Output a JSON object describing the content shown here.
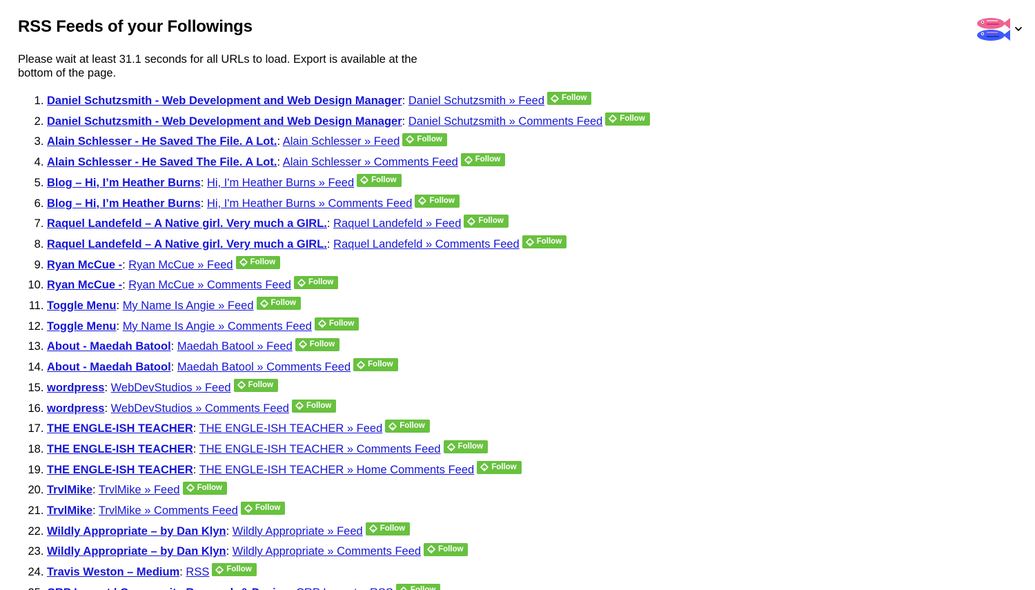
{
  "page": {
    "title": "RSS Feeds of your Followings",
    "intro": "Please wait at least 31.1 seconds for all URLs to load. Export is available at the bottom of the page."
  },
  "header": {
    "avatar_icon": "fish-avatar-icon",
    "menu_icon": "chevron-down-icon"
  },
  "colors": {
    "link": "#1515d6",
    "follow_bg": "#68c13f"
  },
  "follow_label": "Follow",
  "feeds": [
    {
      "site": "Daniel Schutzsmith - Web Development and Web Design Manager",
      "feed": "Daniel Schutzsmith » Feed"
    },
    {
      "site": "Daniel Schutzsmith - Web Development and Web Design Manager",
      "feed": "Daniel Schutzsmith » Comments Feed"
    },
    {
      "site": "Alain Schlesser - He Saved The File. A Lot.",
      "feed": "Alain Schlesser » Feed"
    },
    {
      "site": "Alain Schlesser - He Saved The File. A Lot.",
      "feed": "Alain Schlesser » Comments Feed"
    },
    {
      "site": "Blog – Hi, I’m Heather Burns",
      "feed": "Hi, I'm Heather Burns » Feed"
    },
    {
      "site": "Blog – Hi, I’m Heather Burns",
      "feed": "Hi, I'm Heather Burns » Comments Feed"
    },
    {
      "site": "Raquel Landefeld – A Native girl. Very much a GIRL.",
      "feed": "Raquel Landefeld » Feed"
    },
    {
      "site": "Raquel Landefeld – A Native girl. Very much a GIRL.",
      "feed": "Raquel Landefeld » Comments Feed"
    },
    {
      "site": "Ryan McCue -",
      "feed": "Ryan McCue » Feed"
    },
    {
      "site": "Ryan McCue -",
      "feed": "Ryan McCue » Comments Feed"
    },
    {
      "site": "Toggle Menu",
      "feed": "My Name Is Angie » Feed"
    },
    {
      "site": "Toggle Menu",
      "feed": "My Name Is Angie » Comments Feed"
    },
    {
      "site": "About - Maedah Batool",
      "feed": "Maedah Batool » Feed"
    },
    {
      "site": "About - Maedah Batool",
      "feed": "Maedah Batool » Comments Feed"
    },
    {
      "site": "wordpress",
      "feed": "WebDevStudios » Feed"
    },
    {
      "site": "wordpress",
      "feed": "WebDevStudios » Comments Feed"
    },
    {
      "site": "THE ENGLE-ISH TEACHER",
      "feed": "THE ENGLE-ISH TEACHER » Feed"
    },
    {
      "site": "THE ENGLE-ISH TEACHER",
      "feed": "THE ENGLE-ISH TEACHER » Comments Feed"
    },
    {
      "site": "THE ENGLE-ISH TEACHER",
      "feed": "THE ENGLE-ISH TEACHER » Home Comments Feed"
    },
    {
      "site": "TrvlMike",
      "feed": "TrvlMike » Feed"
    },
    {
      "site": "TrvlMike",
      "feed": "TrvlMike » Comments Feed"
    },
    {
      "site": "Wildly Appropriate – by Dan Klyn",
      "feed": "Wildly Appropriate » Feed"
    },
    {
      "site": "Wildly Appropriate – by Dan Klyn",
      "feed": "Wildly Appropriate » Comments Feed"
    },
    {
      "site": "Travis Weston – Medium",
      "feed": "RSS"
    },
    {
      "site": "CRP Impact | Community Research & Design",
      "feed": "CRP Impact » RSS"
    }
  ]
}
